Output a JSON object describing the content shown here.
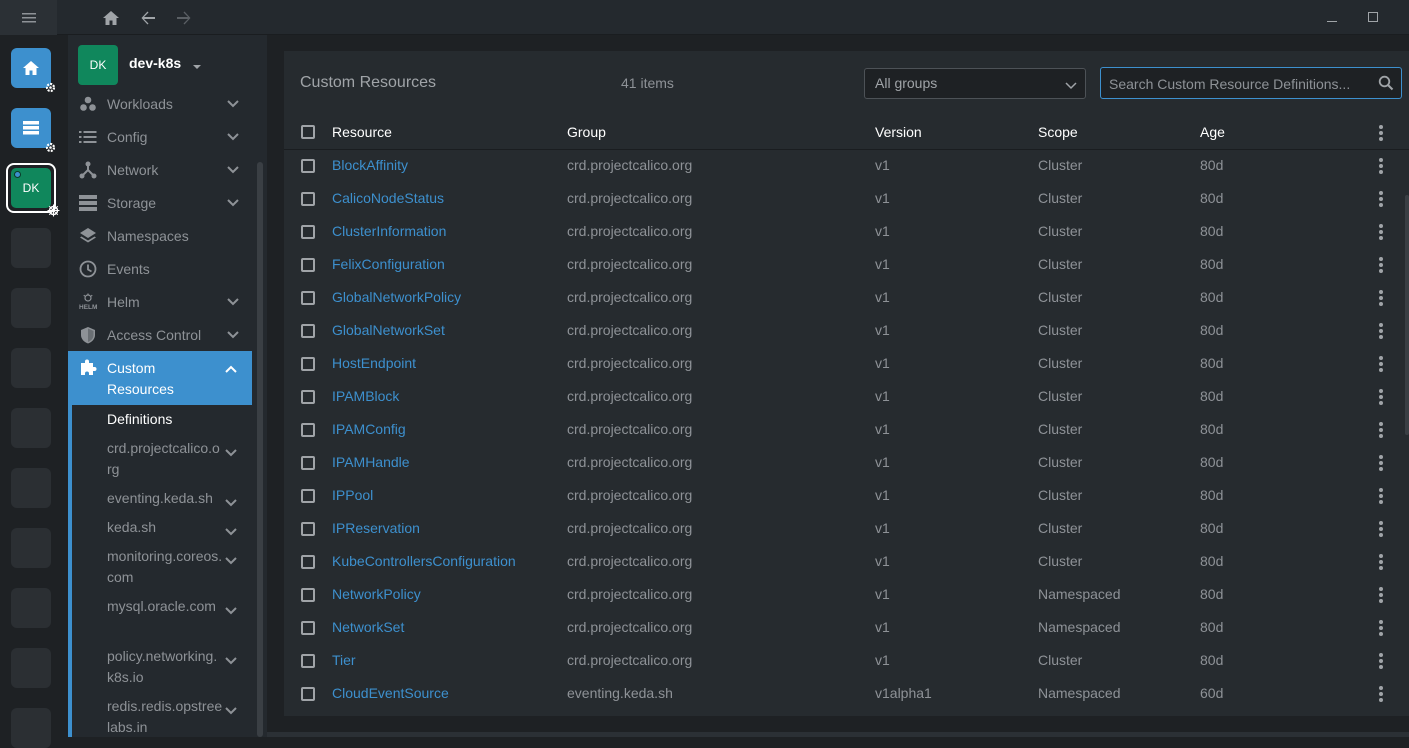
{
  "window": {
    "controls": [
      "minimize",
      "maximize"
    ]
  },
  "cluster": {
    "initials": "DK",
    "name": "dev-k8s"
  },
  "hotbar": {
    "dk_initials": "DK"
  },
  "sidebar": {
    "items": [
      {
        "label": "Workloads",
        "icon": "workloads-icon",
        "expandable": true
      },
      {
        "label": "Config",
        "icon": "config-icon",
        "expandable": true
      },
      {
        "label": "Network",
        "icon": "network-icon",
        "expandable": true
      },
      {
        "label": "Storage",
        "icon": "storage-icon",
        "expandable": true
      },
      {
        "label": "Namespaces",
        "icon": "namespaces-icon",
        "expandable": false
      },
      {
        "label": "Events",
        "icon": "events-icon",
        "expandable": false
      },
      {
        "label": "Helm",
        "icon": "helm-icon",
        "expandable": true
      },
      {
        "label": "Access Control",
        "icon": "access-control-icon",
        "expandable": true
      }
    ],
    "custom": {
      "label": "Custom Resources"
    },
    "sub_items": [
      {
        "label": "Definitions"
      },
      {
        "label": "crd.projectcalico.org"
      },
      {
        "label": "eventing.keda.sh"
      },
      {
        "label": "keda.sh"
      },
      {
        "label": "monitoring.coreos.com"
      },
      {
        "label": "mysql.oracle.com"
      },
      {
        "label": "policy.networking.k8s.io"
      },
      {
        "label": "redis.redis.opstreelabs.in"
      }
    ]
  },
  "main": {
    "title": "Custom Resources",
    "count": "41 items",
    "group_select": "All groups",
    "search_placeholder": "Search Custom Resource Definitions...",
    "columns": [
      "Resource",
      "Group",
      "Version",
      "Scope",
      "Age"
    ],
    "rows": [
      {
        "resource": "BlockAffinity",
        "group": "crd.projectcalico.org",
        "version": "v1",
        "scope": "Cluster",
        "age": "80d"
      },
      {
        "resource": "CalicoNodeStatus",
        "group": "crd.projectcalico.org",
        "version": "v1",
        "scope": "Cluster",
        "age": "80d"
      },
      {
        "resource": "ClusterInformation",
        "group": "crd.projectcalico.org",
        "version": "v1",
        "scope": "Cluster",
        "age": "80d"
      },
      {
        "resource": "FelixConfiguration",
        "group": "crd.projectcalico.org",
        "version": "v1",
        "scope": "Cluster",
        "age": "80d"
      },
      {
        "resource": "GlobalNetworkPolicy",
        "group": "crd.projectcalico.org",
        "version": "v1",
        "scope": "Cluster",
        "age": "80d"
      },
      {
        "resource": "GlobalNetworkSet",
        "group": "crd.projectcalico.org",
        "version": "v1",
        "scope": "Cluster",
        "age": "80d"
      },
      {
        "resource": "HostEndpoint",
        "group": "crd.projectcalico.org",
        "version": "v1",
        "scope": "Cluster",
        "age": "80d"
      },
      {
        "resource": "IPAMBlock",
        "group": "crd.projectcalico.org",
        "version": "v1",
        "scope": "Cluster",
        "age": "80d"
      },
      {
        "resource": "IPAMConfig",
        "group": "crd.projectcalico.org",
        "version": "v1",
        "scope": "Cluster",
        "age": "80d"
      },
      {
        "resource": "IPAMHandle",
        "group": "crd.projectcalico.org",
        "version": "v1",
        "scope": "Cluster",
        "age": "80d"
      },
      {
        "resource": "IPPool",
        "group": "crd.projectcalico.org",
        "version": "v1",
        "scope": "Cluster",
        "age": "80d"
      },
      {
        "resource": "IPReservation",
        "group": "crd.projectcalico.org",
        "version": "v1",
        "scope": "Cluster",
        "age": "80d"
      },
      {
        "resource": "KubeControllersConfiguration",
        "group": "crd.projectcalico.org",
        "version": "v1",
        "scope": "Cluster",
        "age": "80d"
      },
      {
        "resource": "NetworkPolicy",
        "group": "crd.projectcalico.org",
        "version": "v1",
        "scope": "Namespaced",
        "age": "80d"
      },
      {
        "resource": "NetworkSet",
        "group": "crd.projectcalico.org",
        "version": "v1",
        "scope": "Namespaced",
        "age": "80d"
      },
      {
        "resource": "Tier",
        "group": "crd.projectcalico.org",
        "version": "v1",
        "scope": "Cluster",
        "age": "80d"
      },
      {
        "resource": "CloudEventSource",
        "group": "eventing.keda.sh",
        "version": "v1alpha1",
        "scope": "Namespaced",
        "age": "60d"
      }
    ]
  },
  "colors": {
    "accent": "#3d90ce",
    "cluster_green": "#10875c"
  }
}
